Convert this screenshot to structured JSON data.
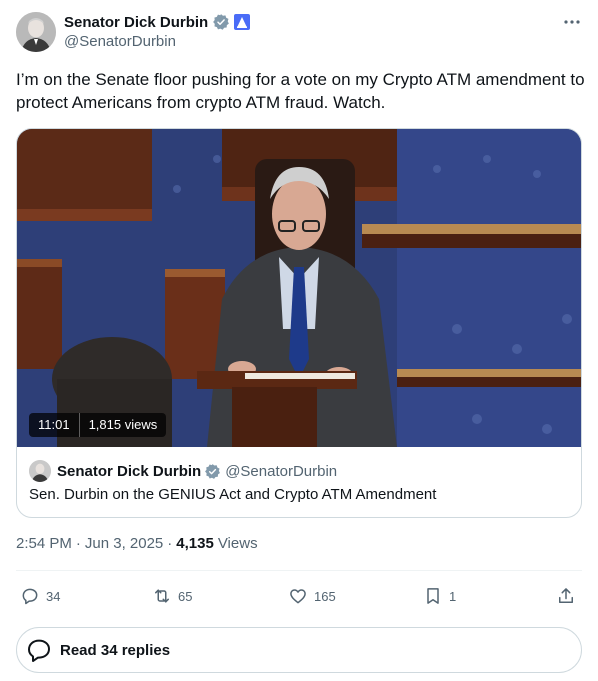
{
  "author": {
    "name": "Senator Dick Durbin",
    "handle": "@SenatorDurbin",
    "verified_color": "#829aab"
  },
  "tweet": {
    "text": "I’m on the Senate floor pushing for a vote on my Crypto ATM amendment to protect Americans from crypto ATM fraud. Watch."
  },
  "video": {
    "duration": "11:01",
    "views": "1,815 views"
  },
  "quote": {
    "name": "Senator Dick Durbin",
    "handle": "@SenatorDurbin",
    "title": "Sen. Durbin on the GENIUS Act and Crypto ATM Amendment"
  },
  "meta": {
    "time": "2:54 PM",
    "date": "Jun 3, 2025",
    "separator": "·",
    "views_count": "4,135",
    "views_label": "Views"
  },
  "actions": {
    "replies": "34",
    "reposts": "65",
    "likes": "165",
    "bookmarks": "1"
  },
  "read_replies": "Read 34 replies",
  "icons": {
    "more": "more-horizontal-icon",
    "reply": "reply-bubble-icon",
    "repost": "repost-icon",
    "like": "heart-icon",
    "bookmark": "bookmark-icon",
    "share": "share-upload-icon"
  }
}
